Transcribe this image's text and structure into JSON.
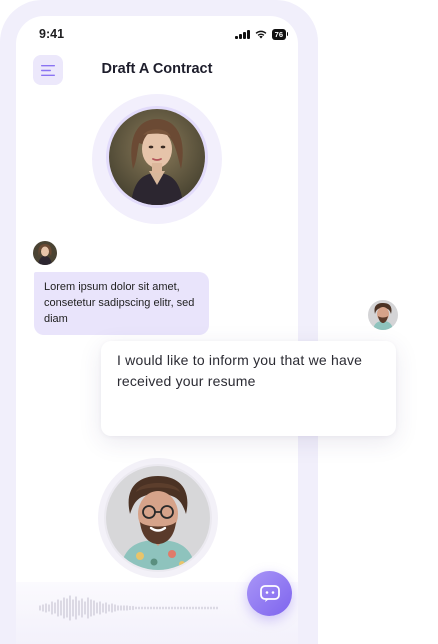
{
  "status_bar": {
    "time": "9:41",
    "battery": "76",
    "icons": [
      "signal-icon",
      "wifi-icon",
      "battery-icon"
    ]
  },
  "header": {
    "title": "Draft A Contract",
    "menu_icon": "menu-icon"
  },
  "conversation": {
    "agent_message": "Lorem ipsum dolor sit amet, consetetur sadipscing elitr, sed diam",
    "user_message": "I would like to inform you that we have received your resume"
  },
  "controls": {
    "chat_icon": "chat-bubble-icon",
    "waveform": "audio-waveform"
  },
  "colors": {
    "accent": "#8a74f2",
    "bubble_background": "#e9e4fb",
    "frame_background": "#f1effb"
  }
}
